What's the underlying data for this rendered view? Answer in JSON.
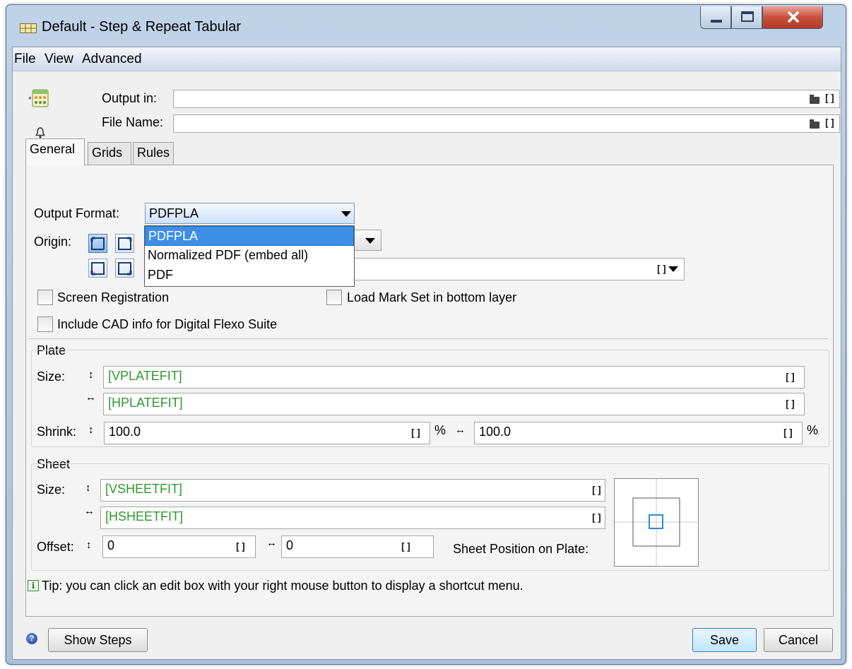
{
  "window": {
    "title": "Default - Step & Repeat Tabular"
  },
  "menu": {
    "items": [
      "File",
      "View",
      "Advanced"
    ]
  },
  "header": {
    "output_in_label": "Output in:",
    "output_in_value": "",
    "file_name_label": "File Name:",
    "file_name_value": "",
    "variable_button": "[]"
  },
  "tabs": [
    {
      "label": "General",
      "active": true
    },
    {
      "label": "Grids",
      "active": false
    },
    {
      "label": "Rules",
      "active": false
    }
  ],
  "general": {
    "output_format_label": "Output Format:",
    "output_format_value": "PDFPLA",
    "output_format_options": [
      "PDFPLA",
      "Normalized PDF (embed all)",
      "PDF"
    ],
    "origin_label": "Origin:",
    "screen_registration_label": "Screen Registration",
    "screen_registration_checked": false,
    "load_mark_set_label": "Load Mark Set in bottom layer",
    "load_mark_set_checked": false,
    "include_cad_label": "Include CAD info for Digital Flexo Suite",
    "include_cad_checked": false
  },
  "plate": {
    "legend": "Plate",
    "size_label": "Size:",
    "vertical_size": "[VPLATEFIT]",
    "horizontal_size": "[HPLATEFIT]",
    "shrink_label": "Shrink:",
    "shrink_vertical": "100.0",
    "shrink_horizontal": "100.0",
    "percent_unit": "%"
  },
  "sheet": {
    "legend": "Sheet",
    "size_label": "Size:",
    "vertical_size": "[VSHEETFIT]",
    "horizontal_size": "[HSHEETFIT]",
    "offset_label": "Offset:",
    "offset_vertical": "0",
    "offset_horizontal": "0",
    "position_label": "Sheet Position on Plate:"
  },
  "tip": {
    "icon": "i",
    "text": "Tip: you can click an edit box with your right mouse button to display a shortcut menu."
  },
  "footer": {
    "help_icon": "?",
    "show_steps_label": "Show Steps",
    "save_label": "Save",
    "cancel_label": "Cancel"
  },
  "glyphs": {
    "vertical_arrow": "↕",
    "horizontal_arrow": "↔"
  },
  "colors": {
    "variable_text": "#2e9a2e",
    "selection": "#3d8ee6",
    "close_button": "#c7503b"
  }
}
